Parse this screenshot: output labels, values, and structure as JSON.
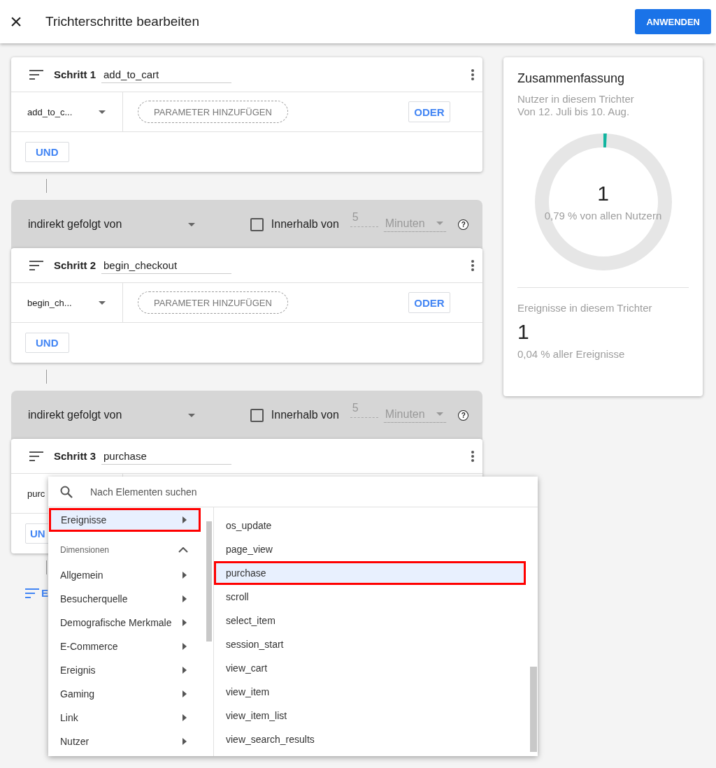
{
  "header": {
    "close": "×",
    "title": "Trichterschritte bearbeiten",
    "apply_button": "ANWENDEN"
  },
  "steps": [
    {
      "label": "Schritt 1",
      "name": "add_to_cart",
      "event": "add_to_c...",
      "add_param": "PARAMETER HINZUFÜGEN",
      "or_button": "ODER",
      "and_button": "UND"
    },
    {
      "transition": {
        "relation": "indirekt gefolgt von",
        "within_label": "Innerhalb von",
        "checked": false,
        "disabled": true,
        "amount": "5",
        "unit": "Minuten",
        "help": "?"
      },
      "label": "Schritt 2",
      "name": "begin_checkout",
      "event": "begin_ch...",
      "add_param": "PARAMETER HINZUFÜGEN",
      "or_button": "ODER",
      "and_button": "UND"
    },
    {
      "transition": {
        "relation": "indirekt gefolgt von",
        "within_label": "Innerhalb von",
        "checked": false,
        "disabled": true,
        "amount": "5",
        "unit": "Minuten",
        "help": "?"
      },
      "label": "Schritt 3",
      "name": "purchase",
      "event": "purc",
      "and_button": "UN"
    }
  ],
  "add_step": {
    "text": "E"
  },
  "summary": {
    "title": "Zusammenfassung",
    "subtitle": "Nutzer in diesem Trichter",
    "date_range": "Von 12. Juli bis 10. Aug.",
    "users": {
      "value": "1",
      "share": "0,79 % von allen Nutzern",
      "level": 0.0079
    },
    "events_label": "Ereignisse in diesem Trichter",
    "events": {
      "value": "1",
      "share": "0,04 % aller Ereignisse"
    }
  },
  "menu": {
    "search_placeholder": "Nach Elementen suchen",
    "top_item": {
      "label": "Ereignisse",
      "selected": true,
      "outlined": true
    },
    "section": {
      "label": "Dimensionen",
      "expanded": true
    },
    "categories": [
      {
        "label": "Allgemein",
        "selected": false
      },
      {
        "label": "Besucherquelle",
        "selected": false
      },
      {
        "label": "Demografische Merkmale",
        "selected": false
      },
      {
        "label": "E-Commerce",
        "selected": false
      },
      {
        "label": "Ereignis",
        "selected": false
      },
      {
        "label": "Gaming",
        "selected": false
      },
      {
        "label": "Link",
        "selected": false
      },
      {
        "label": "Nutzer",
        "selected": false
      }
    ],
    "events": [
      {
        "label": "os_update",
        "selected": false,
        "outlined": false
      },
      {
        "label": "page_view",
        "selected": false,
        "outlined": false
      },
      {
        "label": "purchase",
        "selected": true,
        "outlined": true
      },
      {
        "label": "scroll",
        "selected": false,
        "outlined": false
      },
      {
        "label": "select_item",
        "selected": false,
        "outlined": false
      },
      {
        "label": "session_start",
        "selected": false,
        "outlined": false
      },
      {
        "label": "view_cart",
        "selected": false,
        "outlined": false
      },
      {
        "label": "view_item",
        "selected": false,
        "outlined": false
      },
      {
        "label": "view_item_list",
        "selected": false,
        "outlined": false
      },
      {
        "label": "view_search_results",
        "selected": false,
        "outlined": false
      }
    ]
  }
}
